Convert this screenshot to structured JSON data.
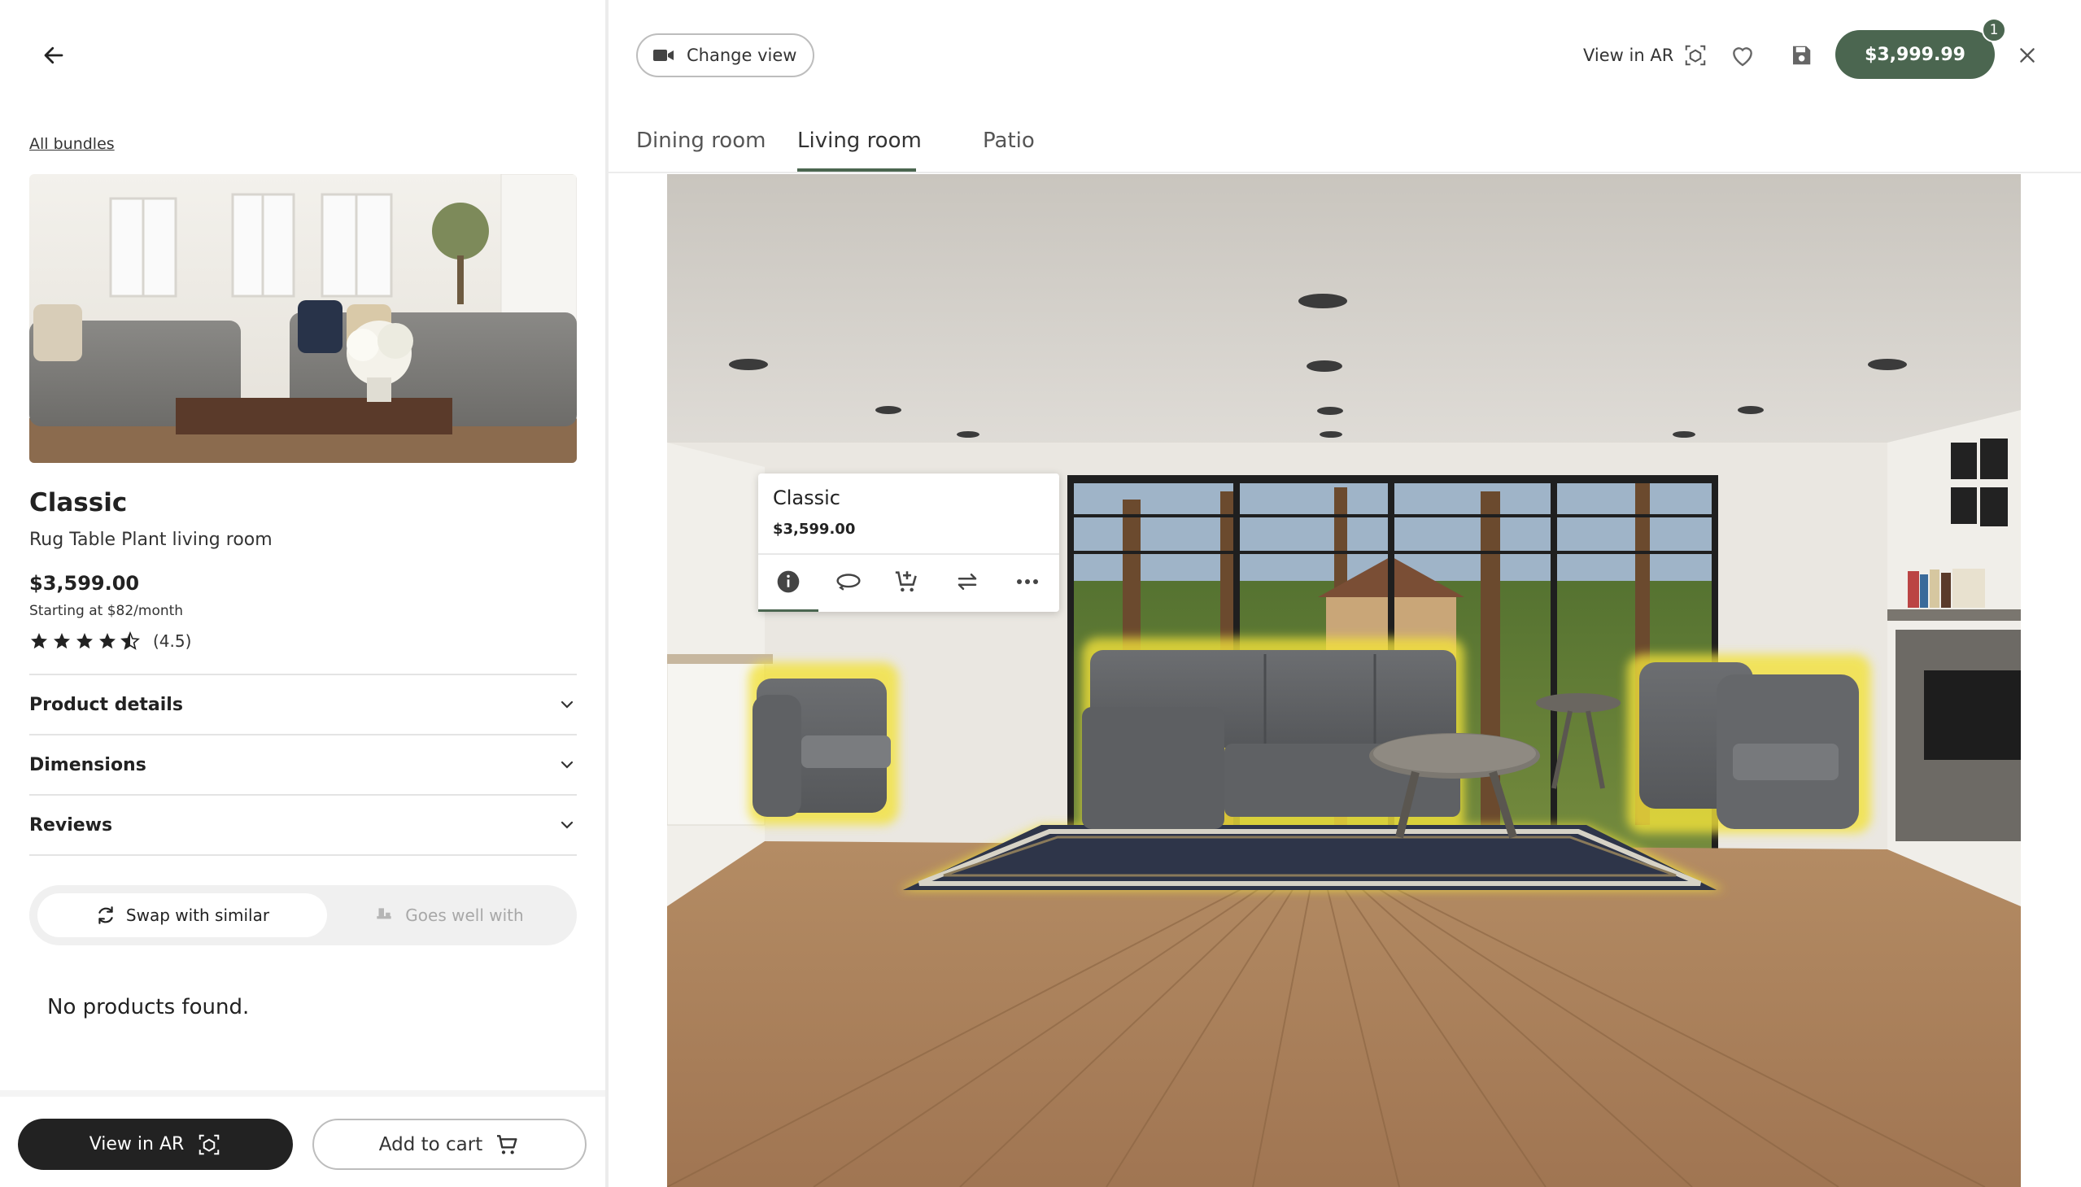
{
  "left_panel": {
    "back_label": "Back",
    "all_bundles": "All bundles",
    "product": {
      "title": "Classic",
      "subtitle": "Rug Table Plant living room",
      "price": "$3,599.00",
      "monthly": "Starting at $82/month",
      "rating_value": 4.5,
      "rating_text": "(4.5)"
    },
    "accordions": [
      {
        "label": "Product details"
      },
      {
        "label": "Dimensions"
      },
      {
        "label": "Reviews"
      }
    ],
    "toggle": {
      "active": "Swap with similar",
      "inactive": "Goes well with"
    },
    "empty_state": "No products found.",
    "bottom": {
      "view_ar": "View in AR",
      "add_to_cart": "Add to cart"
    }
  },
  "toolbar": {
    "change_view": "Change view",
    "view_ar": "View in AR",
    "total_price": "$3,999.99",
    "cart_badge": "1"
  },
  "tabs": [
    {
      "label": "Dining room",
      "active": false
    },
    {
      "label": "Living room",
      "active": true
    },
    {
      "label": "Patio",
      "active": false
    }
  ],
  "popup": {
    "title": "Classic",
    "price": "$3,599.00",
    "actions": [
      "info-icon",
      "rotate-icon",
      "add-to-cart-icon",
      "swap-icon",
      "more-icon"
    ]
  },
  "colors": {
    "accent": "#4b6650",
    "dark_button": "#222222",
    "selection_glow": "#f3e23a"
  }
}
